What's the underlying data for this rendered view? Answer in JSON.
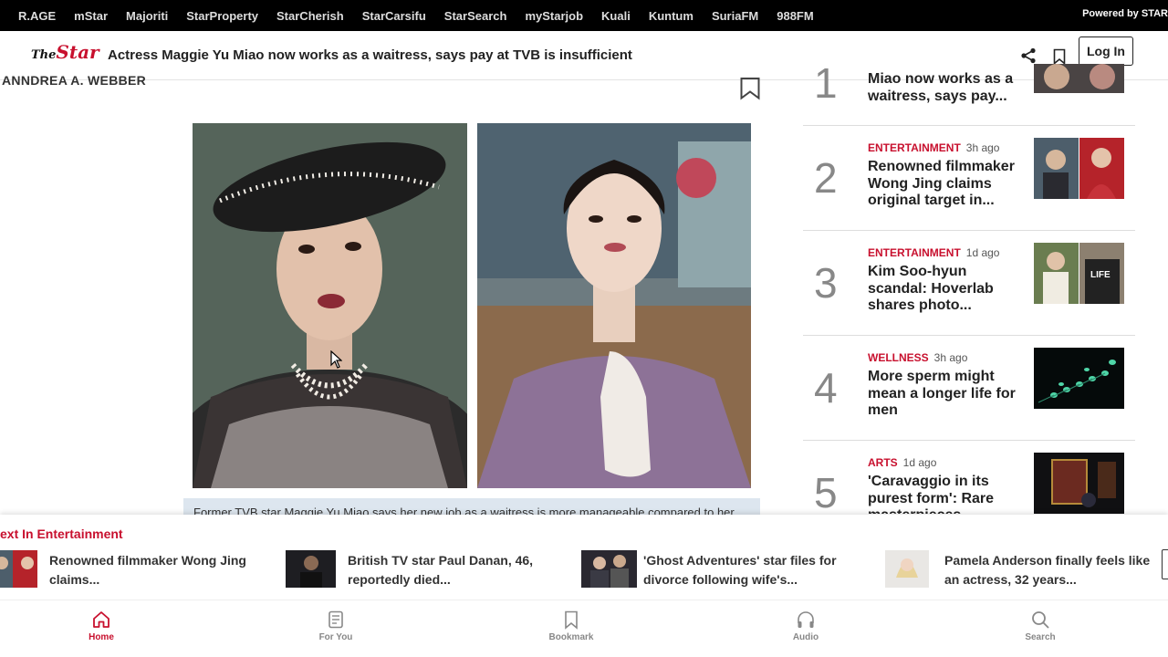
{
  "topnav": {
    "links": [
      "R.AGE",
      "mStar",
      "Majoriti",
      "StarProperty",
      "StarCherish",
      "StarCarsifu",
      "StarSearch",
      "myStarjob",
      "Kuali",
      "Kuntum",
      "SuriaFM",
      "988FM"
    ],
    "powered": "Powered by STAR"
  },
  "header": {
    "logo_small": "The",
    "logo": "Star",
    "headline": "Actress Maggie Yu Miao now works as a waitress, says pay at TVB is insufficient",
    "login": "Log In"
  },
  "article": {
    "author": "ANNDREA A. WEBBER",
    "caption": "Former TVB star Maggie Yu Miao says her new job as a waitress is more manageable compared to her"
  },
  "sidebar": {
    "items": [
      {
        "num": "1",
        "category": "",
        "time": "",
        "title": "Miao now works as a waitress, says pay..."
      },
      {
        "num": "2",
        "category": "ENTERTAINMENT",
        "time": "3h ago",
        "title": "Renowned filmmaker Wong Jing claims original target in..."
      },
      {
        "num": "3",
        "category": "ENTERTAINMENT",
        "time": "1d ago",
        "title": "Kim Soo-hyun scandal: Hoverlab shares photo..."
      },
      {
        "num": "4",
        "category": "WELLNESS",
        "time": "3h ago",
        "title": "More sperm might mean a longer life for men"
      },
      {
        "num": "5",
        "category": "ARTS",
        "time": "1d ago",
        "title": "'Caravaggio in its purest form': Rare masterpieces..."
      }
    ]
  },
  "next": {
    "label": "ext In Entertainment",
    "items": [
      {
        "text": "Renowned filmmaker Wong Jing claims..."
      },
      {
        "text": "British TV star Paul Danan, 46, reportedly died..."
      },
      {
        "text": "'Ghost Adventures' star files for divorce following wife's..."
      },
      {
        "text": "Pamela Anderson finally feels like an actress, 32 years..."
      }
    ]
  },
  "bottomnav": {
    "items": [
      {
        "label": "Home",
        "icon": "home-icon",
        "active": true
      },
      {
        "label": "For You",
        "icon": "for-you-icon",
        "active": false
      },
      {
        "label": "Bookmark",
        "icon": "bookmark-icon",
        "active": false
      },
      {
        "label": "Audio",
        "icon": "headphones-icon",
        "active": false
      },
      {
        "label": "Search",
        "icon": "search-icon",
        "active": false
      }
    ]
  },
  "colors": {
    "accent": "#c8102e",
    "topbar": "#000000",
    "caption_bg": "#dde6ef"
  }
}
